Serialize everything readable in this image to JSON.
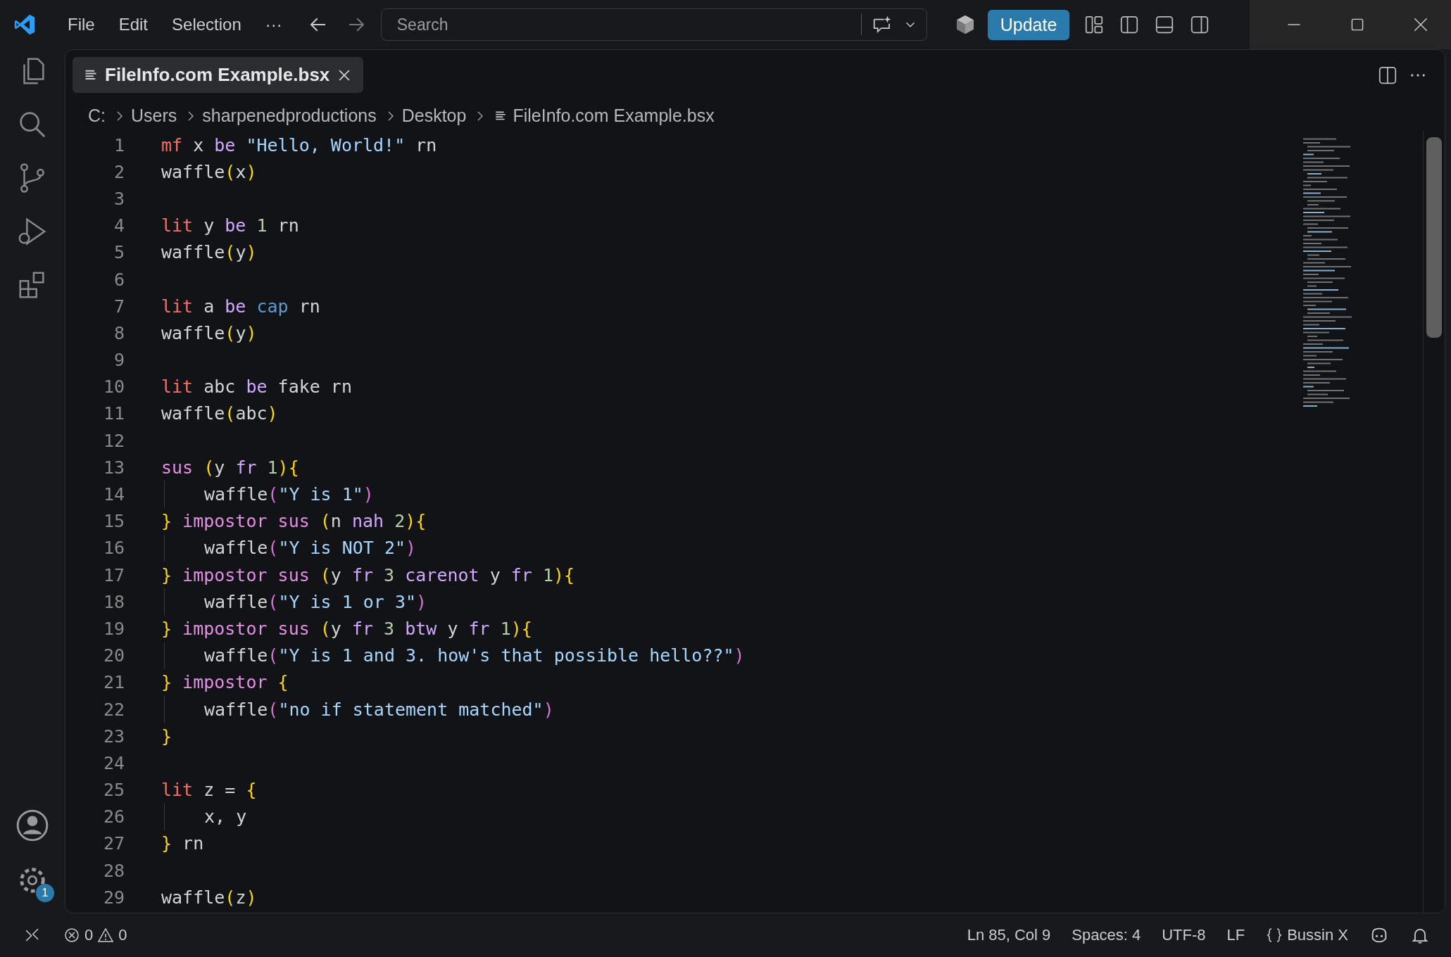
{
  "title_bar": {
    "menu": [
      "File",
      "Edit",
      "Selection",
      "···"
    ],
    "search": {
      "placeholder": "Search"
    },
    "update_button": "Update"
  },
  "tabs": [
    {
      "label": "FileInfo.com Example.bsx",
      "selected": true
    }
  ],
  "breadcrumbs": [
    "C:",
    "Users",
    "sharpenedproductions",
    "Desktop",
    "FileInfo.com Example.bsx"
  ],
  "code_lines": [
    {
      "number": "1",
      "indent": false,
      "tokens": [
        {
          "kind": "decl",
          "text": "mf"
        },
        {
          "kind": "plain",
          "text": " x "
        },
        {
          "kind": "op",
          "text": "be"
        },
        {
          "kind": "str",
          "text": " \"Hello, World!\""
        },
        {
          "kind": "plain",
          "text": " rn"
        }
      ]
    },
    {
      "number": "2",
      "indent": false,
      "tokens": [
        {
          "kind": "plain",
          "text": "waffle"
        },
        {
          "kind": "brace",
          "text": "("
        },
        {
          "kind": "plain",
          "text": "x"
        },
        {
          "kind": "brace",
          "text": ")"
        }
      ]
    },
    {
      "number": "3",
      "indent": false
    },
    {
      "number": "4",
      "indent": false,
      "tokens": [
        {
          "kind": "decl",
          "text": "lit"
        },
        {
          "kind": "plain",
          "text": " y "
        },
        {
          "kind": "op",
          "text": "be"
        },
        {
          "kind": "num",
          "text": " 1"
        },
        {
          "kind": "plain",
          "text": " rn"
        }
      ]
    },
    {
      "number": "5",
      "indent": false,
      "tokens": [
        {
          "kind": "plain",
          "text": "waffle"
        },
        {
          "kind": "brace",
          "text": "("
        },
        {
          "kind": "plain",
          "text": "y"
        },
        {
          "kind": "brace",
          "text": ")"
        }
      ]
    },
    {
      "number": "6",
      "indent": false
    },
    {
      "number": "7",
      "indent": false,
      "tokens": [
        {
          "kind": "decl",
          "text": "lit"
        },
        {
          "kind": "plain",
          "text": " a "
        },
        {
          "kind": "op",
          "text": "be"
        },
        {
          "kind": "const",
          "text": " cap"
        },
        {
          "kind": "plain",
          "text": " rn"
        }
      ]
    },
    {
      "number": "8",
      "indent": false,
      "tokens": [
        {
          "kind": "plain",
          "text": "waffle"
        },
        {
          "kind": "brace",
          "text": "("
        },
        {
          "kind": "plain",
          "text": "y"
        },
        {
          "kind": "brace",
          "text": ")"
        }
      ]
    },
    {
      "number": "9",
      "indent": false
    },
    {
      "number": "10",
      "indent": false,
      "tokens": [
        {
          "kind": "decl",
          "text": "lit"
        },
        {
          "kind": "plain",
          "text": " abc "
        },
        {
          "kind": "op",
          "text": "be"
        },
        {
          "kind": "plain",
          "text": " fake rn"
        }
      ]
    },
    {
      "number": "11",
      "indent": false,
      "tokens": [
        {
          "kind": "plain",
          "text": "waffle"
        },
        {
          "kind": "brace",
          "text": "("
        },
        {
          "kind": "plain",
          "text": "abc"
        },
        {
          "kind": "brace",
          "text": ")"
        }
      ]
    },
    {
      "number": "12",
      "indent": false
    },
    {
      "number": "13",
      "indent": false,
      "tokens": [
        {
          "kind": "ctrl",
          "text": "sus"
        },
        {
          "kind": "brace",
          "text": " ("
        },
        {
          "kind": "plain",
          "text": "y "
        },
        {
          "kind": "op",
          "text": "fr"
        },
        {
          "kind": "num",
          "text": " 1"
        },
        {
          "kind": "brace",
          "text": "){"
        }
      ]
    },
    {
      "number": "14",
      "indent": true,
      "tokens": [
        {
          "kind": "plain",
          "text": "waffle"
        },
        {
          "kind": "paren",
          "text": "("
        },
        {
          "kind": "str",
          "text": "\"Y is 1\""
        },
        {
          "kind": "paren",
          "text": ")"
        }
      ]
    },
    {
      "number": "15",
      "indent": false,
      "tokens": [
        {
          "kind": "brace",
          "text": "}"
        },
        {
          "kind": "ctrl",
          "text": " impostor sus"
        },
        {
          "kind": "brace",
          "text": " ("
        },
        {
          "kind": "plain",
          "text": "n "
        },
        {
          "kind": "op",
          "text": "nah"
        },
        {
          "kind": "num",
          "text": " 2"
        },
        {
          "kind": "brace",
          "text": "){"
        }
      ]
    },
    {
      "number": "16",
      "indent": true,
      "tokens": [
        {
          "kind": "plain",
          "text": "waffle"
        },
        {
          "kind": "paren",
          "text": "("
        },
        {
          "kind": "str",
          "text": "\"Y is NOT 2\""
        },
        {
          "kind": "paren",
          "text": ")"
        }
      ]
    },
    {
      "number": "17",
      "indent": false,
      "tokens": [
        {
          "kind": "brace",
          "text": "}"
        },
        {
          "kind": "ctrl",
          "text": " impostor sus"
        },
        {
          "kind": "brace",
          "text": " ("
        },
        {
          "kind": "plain",
          "text": "y "
        },
        {
          "kind": "op",
          "text": "fr"
        },
        {
          "kind": "num",
          "text": " 3"
        },
        {
          "kind": "op",
          "text": " carenot"
        },
        {
          "kind": "plain",
          "text": " y "
        },
        {
          "kind": "op",
          "text": "fr"
        },
        {
          "kind": "num",
          "text": " 1"
        },
        {
          "kind": "brace",
          "text": "){"
        }
      ]
    },
    {
      "number": "18",
      "indent": true,
      "tokens": [
        {
          "kind": "plain",
          "text": "waffle"
        },
        {
          "kind": "paren",
          "text": "("
        },
        {
          "kind": "str",
          "text": "\"Y is 1 or 3\""
        },
        {
          "kind": "paren",
          "text": ")"
        }
      ]
    },
    {
      "number": "19",
      "indent": false,
      "tokens": [
        {
          "kind": "brace",
          "text": "}"
        },
        {
          "kind": "ctrl",
          "text": " impostor sus"
        },
        {
          "kind": "brace",
          "text": " ("
        },
        {
          "kind": "plain",
          "text": "y "
        },
        {
          "kind": "op",
          "text": "fr"
        },
        {
          "kind": "num",
          "text": " 3"
        },
        {
          "kind": "op",
          "text": " btw"
        },
        {
          "kind": "plain",
          "text": " y "
        },
        {
          "kind": "op",
          "text": "fr"
        },
        {
          "kind": "num",
          "text": " 1"
        },
        {
          "kind": "brace",
          "text": "){"
        }
      ]
    },
    {
      "number": "20",
      "indent": true,
      "tokens": [
        {
          "kind": "plain",
          "text": "waffle"
        },
        {
          "kind": "paren",
          "text": "("
        },
        {
          "kind": "str",
          "text": "\"Y is 1 and 3. how's that possible hello??\""
        },
        {
          "kind": "paren",
          "text": ")"
        }
      ]
    },
    {
      "number": "21",
      "indent": false,
      "tokens": [
        {
          "kind": "brace",
          "text": "}"
        },
        {
          "kind": "ctrl",
          "text": " impostor"
        },
        {
          "kind": "brace",
          "text": " {"
        }
      ]
    },
    {
      "number": "22",
      "indent": true,
      "tokens": [
        {
          "kind": "plain",
          "text": "waffle"
        },
        {
          "kind": "paren",
          "text": "("
        },
        {
          "kind": "str",
          "text": "\"no if statement matched\""
        },
        {
          "kind": "paren",
          "text": ")"
        }
      ]
    },
    {
      "number": "23",
      "indent": false,
      "tokens": [
        {
          "kind": "brace",
          "text": "}"
        }
      ]
    },
    {
      "number": "24",
      "indent": false
    },
    {
      "number": "25",
      "indent": false,
      "tokens": [
        {
          "kind": "decl",
          "text": "lit"
        },
        {
          "kind": "plain",
          "text": " z = "
        },
        {
          "kind": "brace",
          "text": "{"
        }
      ]
    },
    {
      "number": "26",
      "indent": true,
      "tokens": [
        {
          "kind": "plain",
          "text": "x, y"
        }
      ]
    },
    {
      "number": "27",
      "indent": false,
      "tokens": [
        {
          "kind": "brace",
          "text": "}"
        },
        {
          "kind": "plain",
          "text": " rn"
        }
      ]
    },
    {
      "number": "28",
      "indent": false
    },
    {
      "number": "29",
      "indent": false,
      "tokens": [
        {
          "kind": "plain",
          "text": "waffle"
        },
        {
          "kind": "brace",
          "text": "("
        },
        {
          "kind": "plain",
          "text": "z"
        },
        {
          "kind": "brace",
          "text": ")"
        }
      ]
    }
  ],
  "activity_bar": {
    "settings_badge": "1"
  },
  "status_bar": {
    "errors": "0",
    "warnings": "0",
    "items": [
      "Ln 85, Col 9",
      "Spaces: 4",
      "UTF-8",
      "LF"
    ],
    "language": "Bussin X"
  }
}
